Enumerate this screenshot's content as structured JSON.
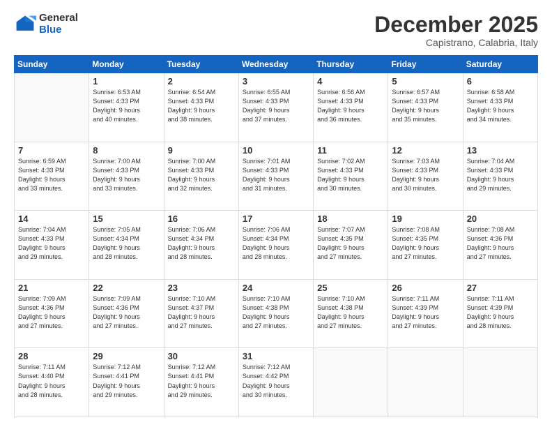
{
  "logo": {
    "general": "General",
    "blue": "Blue"
  },
  "header": {
    "month": "December 2025",
    "location": "Capistrano, Calabria, Italy"
  },
  "weekdays": [
    "Sunday",
    "Monday",
    "Tuesday",
    "Wednesday",
    "Thursday",
    "Friday",
    "Saturday"
  ],
  "weeks": [
    [
      {
        "day": "",
        "info": ""
      },
      {
        "day": "1",
        "info": "Sunrise: 6:53 AM\nSunset: 4:33 PM\nDaylight: 9 hours\nand 40 minutes."
      },
      {
        "day": "2",
        "info": "Sunrise: 6:54 AM\nSunset: 4:33 PM\nDaylight: 9 hours\nand 38 minutes."
      },
      {
        "day": "3",
        "info": "Sunrise: 6:55 AM\nSunset: 4:33 PM\nDaylight: 9 hours\nand 37 minutes."
      },
      {
        "day": "4",
        "info": "Sunrise: 6:56 AM\nSunset: 4:33 PM\nDaylight: 9 hours\nand 36 minutes."
      },
      {
        "day": "5",
        "info": "Sunrise: 6:57 AM\nSunset: 4:33 PM\nDaylight: 9 hours\nand 35 minutes."
      },
      {
        "day": "6",
        "info": "Sunrise: 6:58 AM\nSunset: 4:33 PM\nDaylight: 9 hours\nand 34 minutes."
      }
    ],
    [
      {
        "day": "7",
        "info": "Sunrise: 6:59 AM\nSunset: 4:33 PM\nDaylight: 9 hours\nand 33 minutes."
      },
      {
        "day": "8",
        "info": "Sunrise: 7:00 AM\nSunset: 4:33 PM\nDaylight: 9 hours\nand 33 minutes."
      },
      {
        "day": "9",
        "info": "Sunrise: 7:00 AM\nSunset: 4:33 PM\nDaylight: 9 hours\nand 32 minutes."
      },
      {
        "day": "10",
        "info": "Sunrise: 7:01 AM\nSunset: 4:33 PM\nDaylight: 9 hours\nand 31 minutes."
      },
      {
        "day": "11",
        "info": "Sunrise: 7:02 AM\nSunset: 4:33 PM\nDaylight: 9 hours\nand 30 minutes."
      },
      {
        "day": "12",
        "info": "Sunrise: 7:03 AM\nSunset: 4:33 PM\nDaylight: 9 hours\nand 30 minutes."
      },
      {
        "day": "13",
        "info": "Sunrise: 7:04 AM\nSunset: 4:33 PM\nDaylight: 9 hours\nand 29 minutes."
      }
    ],
    [
      {
        "day": "14",
        "info": "Sunrise: 7:04 AM\nSunset: 4:33 PM\nDaylight: 9 hours\nand 29 minutes."
      },
      {
        "day": "15",
        "info": "Sunrise: 7:05 AM\nSunset: 4:34 PM\nDaylight: 9 hours\nand 28 minutes."
      },
      {
        "day": "16",
        "info": "Sunrise: 7:06 AM\nSunset: 4:34 PM\nDaylight: 9 hours\nand 28 minutes."
      },
      {
        "day": "17",
        "info": "Sunrise: 7:06 AM\nSunset: 4:34 PM\nDaylight: 9 hours\nand 28 minutes."
      },
      {
        "day": "18",
        "info": "Sunrise: 7:07 AM\nSunset: 4:35 PM\nDaylight: 9 hours\nand 27 minutes."
      },
      {
        "day": "19",
        "info": "Sunrise: 7:08 AM\nSunset: 4:35 PM\nDaylight: 9 hours\nand 27 minutes."
      },
      {
        "day": "20",
        "info": "Sunrise: 7:08 AM\nSunset: 4:36 PM\nDaylight: 9 hours\nand 27 minutes."
      }
    ],
    [
      {
        "day": "21",
        "info": "Sunrise: 7:09 AM\nSunset: 4:36 PM\nDaylight: 9 hours\nand 27 minutes."
      },
      {
        "day": "22",
        "info": "Sunrise: 7:09 AM\nSunset: 4:36 PM\nDaylight: 9 hours\nand 27 minutes."
      },
      {
        "day": "23",
        "info": "Sunrise: 7:10 AM\nSunset: 4:37 PM\nDaylight: 9 hours\nand 27 minutes."
      },
      {
        "day": "24",
        "info": "Sunrise: 7:10 AM\nSunset: 4:38 PM\nDaylight: 9 hours\nand 27 minutes."
      },
      {
        "day": "25",
        "info": "Sunrise: 7:10 AM\nSunset: 4:38 PM\nDaylight: 9 hours\nand 27 minutes."
      },
      {
        "day": "26",
        "info": "Sunrise: 7:11 AM\nSunset: 4:39 PM\nDaylight: 9 hours\nand 27 minutes."
      },
      {
        "day": "27",
        "info": "Sunrise: 7:11 AM\nSunset: 4:39 PM\nDaylight: 9 hours\nand 28 minutes."
      }
    ],
    [
      {
        "day": "28",
        "info": "Sunrise: 7:11 AM\nSunset: 4:40 PM\nDaylight: 9 hours\nand 28 minutes."
      },
      {
        "day": "29",
        "info": "Sunrise: 7:12 AM\nSunset: 4:41 PM\nDaylight: 9 hours\nand 29 minutes."
      },
      {
        "day": "30",
        "info": "Sunrise: 7:12 AM\nSunset: 4:41 PM\nDaylight: 9 hours\nand 29 minutes."
      },
      {
        "day": "31",
        "info": "Sunrise: 7:12 AM\nSunset: 4:42 PM\nDaylight: 9 hours\nand 30 minutes."
      },
      {
        "day": "",
        "info": ""
      },
      {
        "day": "",
        "info": ""
      },
      {
        "day": "",
        "info": ""
      }
    ]
  ]
}
